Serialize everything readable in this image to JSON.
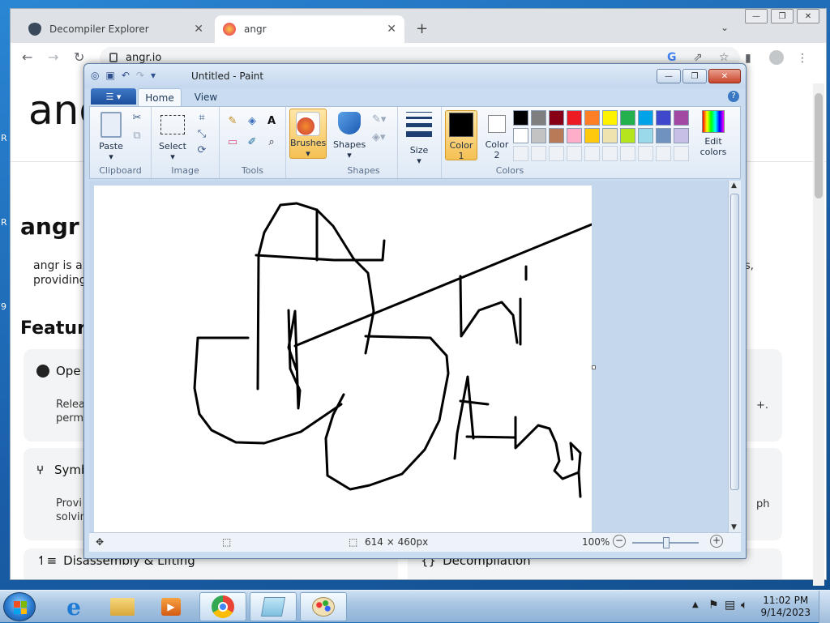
{
  "desktop": {
    "fragment_left_1": "R",
    "fragment_left_2": "R",
    "fragment_left_3": "9"
  },
  "chrome": {
    "tabs": [
      {
        "label": "Decompiler Explorer"
      },
      {
        "label": "angr"
      }
    ],
    "url": "angr.io",
    "page": {
      "logo_text": "angr",
      "heading": "angr",
      "intro_line1": "angr is a",
      "intro_line2": "providing",
      "intro_right": "s,",
      "features_heading": "Feature",
      "cards": [
        {
          "title": "Ope",
          "text1": "Relea",
          "text2": "permi",
          "right": "+."
        },
        {
          "title": "Symb",
          "text1": "Provi",
          "text2": "solvin",
          "right": "ph"
        },
        {
          "title": "Disassembly & Lifting"
        },
        {
          "title": "Decompilation"
        }
      ]
    }
  },
  "paint": {
    "title": "Untitled - Paint",
    "tabs": {
      "home": "Home",
      "view": "View"
    },
    "groups": {
      "clipboard": "Clipboard",
      "image": "Image",
      "tools": "Tools",
      "shapes": "Shapes",
      "colors": "Colors"
    },
    "buttons": {
      "paste": "Paste",
      "select": "Select",
      "brushes": "Brushes",
      "shapes": "Shapes",
      "size": "Size",
      "color1_line1": "Color",
      "color1_line2": "1",
      "color2_line1": "Color",
      "color2_line2": "2",
      "edit_colors_line1": "Edit",
      "edit_colors_line2": "colors"
    },
    "palette_row1": [
      "#000000",
      "#7f7f7f",
      "#880015",
      "#ed1c24",
      "#ff7f27",
      "#fff200",
      "#22b14c",
      "#00a2e8",
      "#3f48cc",
      "#a349a4"
    ],
    "palette_row2": [
      "#ffffff",
      "#c3c3c3",
      "#b97a57",
      "#ffaec9",
      "#ffc90e",
      "#efe4b0",
      "#b5e61d",
      "#99d9ea",
      "#7092be",
      "#c8bfe7"
    ],
    "color1": "#000000",
    "color2": "#ffffff",
    "status": {
      "size": "614 × 460px",
      "zoom": "100%"
    }
  },
  "taskbar": {
    "time": "11:02 PM",
    "date": "9/14/2023"
  }
}
